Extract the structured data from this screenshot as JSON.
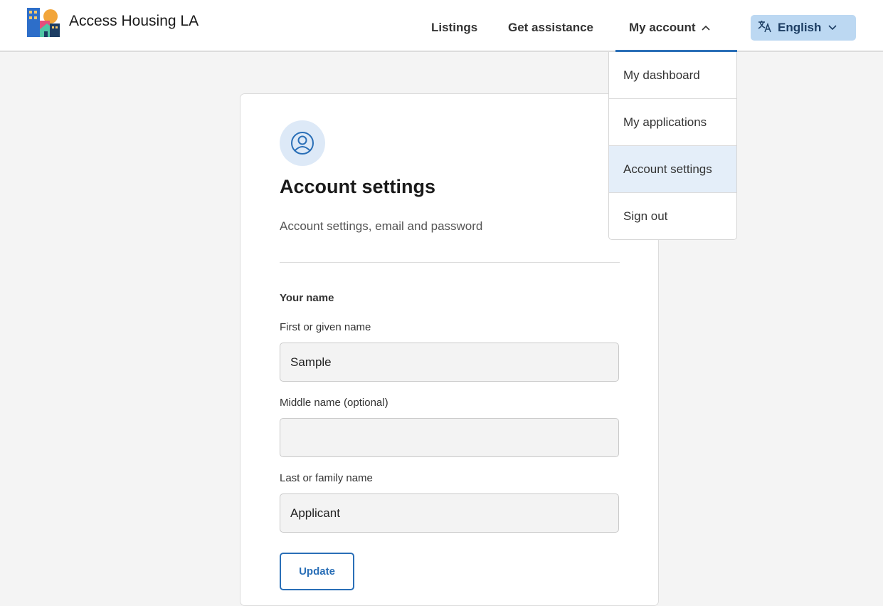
{
  "header": {
    "brand": "Access Housing LA",
    "nav": {
      "listings": "Listings",
      "get_assistance": "Get assistance",
      "my_account": "My account"
    },
    "language": {
      "label": "English",
      "icon": "translate-icon"
    }
  },
  "account_menu": {
    "items": [
      {
        "label": "My dashboard",
        "active": false
      },
      {
        "label": "My applications",
        "active": false
      },
      {
        "label": "Account settings",
        "active": true
      },
      {
        "label": "Sign out",
        "active": false
      }
    ]
  },
  "card": {
    "icon": "profile-icon",
    "title": "Account settings",
    "subtitle": "Account settings, email and password",
    "section_label": "Your name",
    "fields": {
      "first_name": {
        "label": "First or given name",
        "value": "Sample"
      },
      "middle_name": {
        "label": "Middle name (optional)",
        "value": ""
      },
      "last_name": {
        "label": "Last or family name",
        "value": "Applicant"
      }
    },
    "update_label": "Update"
  },
  "colors": {
    "accent": "#2a6fb7",
    "language_button_bg": "#bcd8f2",
    "active_menu_bg": "#e4eef9",
    "page_bg": "#f4f4f4"
  }
}
